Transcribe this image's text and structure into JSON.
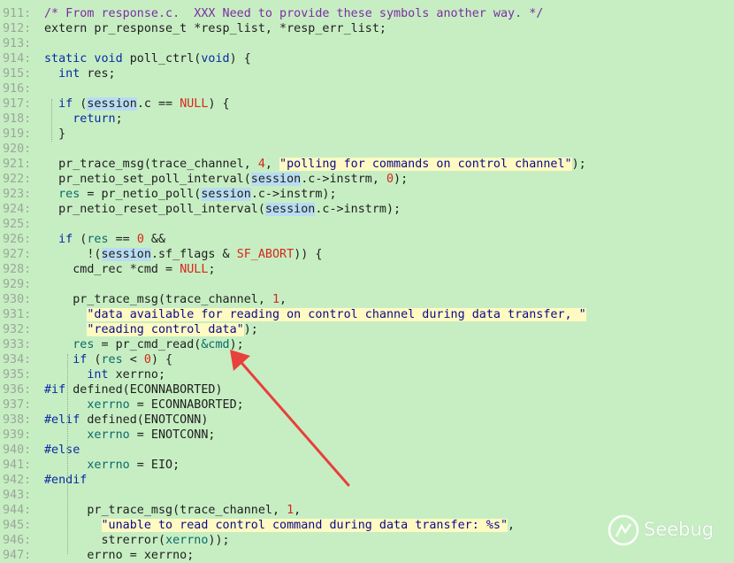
{
  "editor": {
    "lines": [
      {
        "n": "911:",
        "t": [
          [
            "cm",
            "/* From response.c.  XXX Need to provide these symbols another way. */"
          ]
        ]
      },
      {
        "n": "912:",
        "t": [
          [
            "",
            "extern pr_response_t *resp_list, *resp_err_list;"
          ]
        ]
      },
      {
        "n": "913:",
        "t": []
      },
      {
        "n": "914:",
        "t": [
          [
            "kw",
            "static void "
          ],
          [
            "",
            "poll_ctrl("
          ],
          [
            "kw",
            "void"
          ],
          [
            "",
            ") {"
          ]
        ]
      },
      {
        "n": "915:",
        "t": [
          [
            "",
            "  "
          ],
          [
            "kw",
            "int"
          ],
          [
            "",
            " res;"
          ]
        ]
      },
      {
        "n": "916:",
        "t": []
      },
      {
        "n": "917:",
        "t": [
          [
            "",
            "  "
          ],
          [
            "kw",
            "if"
          ],
          [
            "",
            " ("
          ],
          [
            "ses",
            "session"
          ],
          [
            "",
            ".c == "
          ],
          [
            "nul",
            "NULL"
          ],
          [
            "",
            ") {"
          ]
        ]
      },
      {
        "n": "918:",
        "t": [
          [
            "",
            "    "
          ],
          [
            "kw",
            "return"
          ],
          [
            "",
            ";"
          ]
        ]
      },
      {
        "n": "919:",
        "t": [
          [
            "",
            "  }"
          ]
        ]
      },
      {
        "n": "920:",
        "t": []
      },
      {
        "n": "921:",
        "t": [
          [
            "",
            "  pr_trace_msg(trace_channel, "
          ],
          [
            "num",
            "4"
          ],
          [
            "",
            ", "
          ],
          [
            "str",
            "\"polling for commands on control channel\""
          ],
          [
            "",
            ");"
          ]
        ]
      },
      {
        "n": "922:",
        "t": [
          [
            "",
            "  pr_netio_set_poll_interval("
          ],
          [
            "ses",
            "session"
          ],
          [
            "",
            ".c->instrm, "
          ],
          [
            "num",
            "0"
          ],
          [
            "",
            ");"
          ]
        ]
      },
      {
        "n": "923:",
        "t": [
          [
            "",
            "  "
          ],
          [
            "fn",
            "res"
          ],
          [
            "",
            " = pr_netio_poll("
          ],
          [
            "ses",
            "session"
          ],
          [
            "",
            ".c->instrm);"
          ]
        ]
      },
      {
        "n": "924:",
        "t": [
          [
            "",
            "  pr_netio_reset_poll_interval("
          ],
          [
            "ses",
            "session"
          ],
          [
            "",
            ".c->instrm);"
          ]
        ]
      },
      {
        "n": "925:",
        "t": []
      },
      {
        "n": "926:",
        "t": [
          [
            "",
            "  "
          ],
          [
            "kw",
            "if"
          ],
          [
            "",
            " ("
          ],
          [
            "fn",
            "res"
          ],
          [
            "",
            " == "
          ],
          [
            "num",
            "0"
          ],
          [
            "",
            " &&"
          ]
        ]
      },
      {
        "n": "927:",
        "t": [
          [
            "",
            "      !("
          ],
          [
            "ses",
            "session"
          ],
          [
            "",
            ".sf_flags & "
          ],
          [
            "nul",
            "SF_ABORT"
          ],
          [
            "",
            ")) {"
          ]
        ]
      },
      {
        "n": "928:",
        "t": [
          [
            "",
            "    cmd_rec *cmd = "
          ],
          [
            "nul",
            "NULL"
          ],
          [
            "",
            ";"
          ]
        ]
      },
      {
        "n": "929:",
        "t": []
      },
      {
        "n": "930:",
        "t": [
          [
            "",
            "    pr_trace_msg(trace_channel, "
          ],
          [
            "num",
            "1"
          ],
          [
            "",
            ","
          ]
        ]
      },
      {
        "n": "931:",
        "t": [
          [
            "",
            "      "
          ],
          [
            "str",
            "\"data available for reading on control channel during data transfer, \""
          ]
        ]
      },
      {
        "n": "932:",
        "t": [
          [
            "",
            "      "
          ],
          [
            "str",
            "\"reading control data\""
          ],
          [
            "",
            ");"
          ]
        ]
      },
      {
        "n": "933:",
        "t": [
          [
            "",
            "    "
          ],
          [
            "fn",
            "res"
          ],
          [
            "",
            " = pr_cmd_read("
          ],
          [
            "fn",
            "&cmd"
          ],
          [
            "",
            ");"
          ]
        ]
      },
      {
        "n": "934:",
        "t": [
          [
            "",
            "    "
          ],
          [
            "kw",
            "if"
          ],
          [
            "",
            " ("
          ],
          [
            "fn",
            "res"
          ],
          [
            "",
            " < "
          ],
          [
            "num",
            "0"
          ],
          [
            "",
            ") {"
          ]
        ]
      },
      {
        "n": "935:",
        "t": [
          [
            "",
            "      "
          ],
          [
            "kw",
            "int"
          ],
          [
            "",
            " xerrno;"
          ]
        ]
      },
      {
        "n": "936:",
        "t": [
          [
            "kw",
            "#if"
          ],
          [
            "",
            " defined(ECONNABORTED)"
          ]
        ]
      },
      {
        "n": "937:",
        "t": [
          [
            "",
            "      "
          ],
          [
            "fn",
            "xerrno"
          ],
          [
            "",
            " = ECONNABORTED;"
          ]
        ]
      },
      {
        "n": "938:",
        "t": [
          [
            "kw",
            "#elif"
          ],
          [
            "",
            " defined(ENOTCONN)"
          ]
        ]
      },
      {
        "n": "939:",
        "t": [
          [
            "",
            "      "
          ],
          [
            "fn",
            "xerrno"
          ],
          [
            "",
            " = ENOTCONN;"
          ]
        ]
      },
      {
        "n": "940:",
        "t": [
          [
            "kw",
            "#else"
          ]
        ]
      },
      {
        "n": "941:",
        "t": [
          [
            "",
            "      "
          ],
          [
            "fn",
            "xerrno"
          ],
          [
            "",
            " = EIO;"
          ]
        ]
      },
      {
        "n": "942:",
        "t": [
          [
            "kw",
            "#endif"
          ]
        ]
      },
      {
        "n": "943:",
        "t": []
      },
      {
        "n": "944:",
        "t": [
          [
            "",
            "      pr_trace_msg(trace_channel, "
          ],
          [
            "num",
            "1"
          ],
          [
            "",
            ","
          ]
        ]
      },
      {
        "n": "945:",
        "t": [
          [
            "",
            "        "
          ],
          [
            "str",
            "\"unable to read control command during data transfer: %s\""
          ],
          [
            "",
            ","
          ]
        ]
      },
      {
        "n": "946:",
        "t": [
          [
            "",
            "        strerror("
          ],
          [
            "fn",
            "xerrno"
          ],
          [
            "",
            "));"
          ]
        ]
      },
      {
        "n": "947:",
        "t": [
          [
            "",
            "      errno = xerrno;"
          ]
        ]
      }
    ]
  },
  "watermark": {
    "text": "Seebug"
  },
  "colors": {
    "background": "#c7eec3",
    "arrow": "#e8403c"
  }
}
